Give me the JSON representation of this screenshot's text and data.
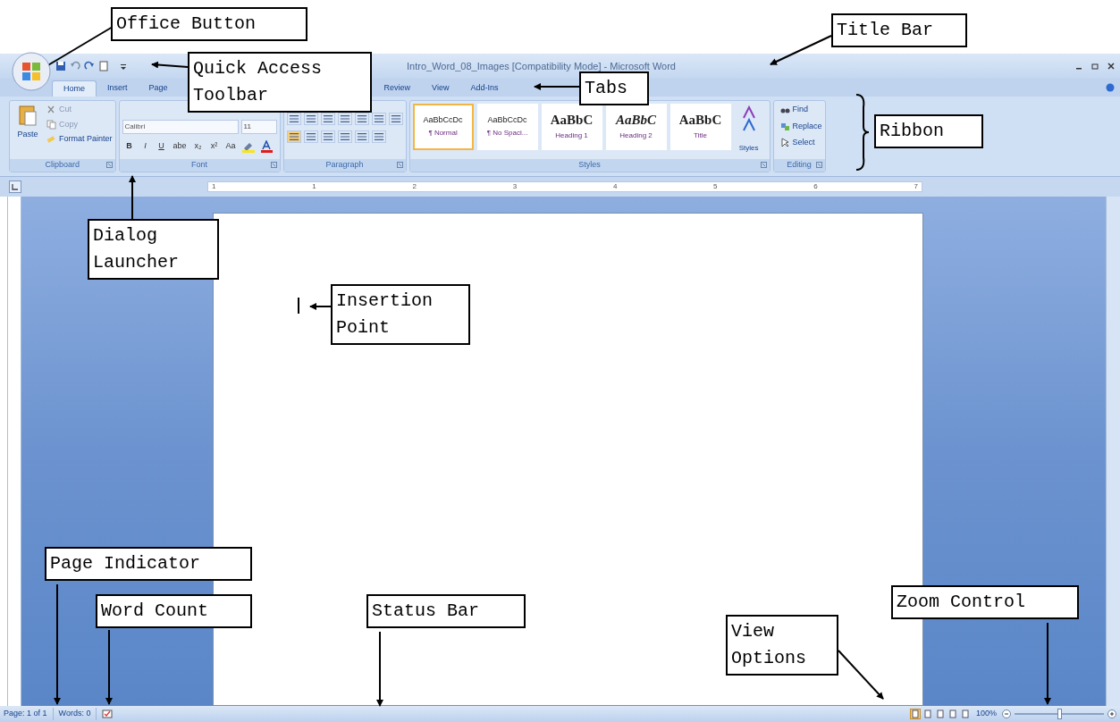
{
  "window": {
    "title": "Intro_Word_08_Images [Compatibility Mode] - Microsoft Word"
  },
  "tabs": [
    {
      "label": "Home",
      "selected": true
    },
    {
      "label": "Insert",
      "selected": false
    },
    {
      "label": "Page",
      "selected": false
    },
    {
      "label": "Review",
      "selected": false
    },
    {
      "label": "View",
      "selected": false
    },
    {
      "label": "Add-Ins",
      "selected": false
    }
  ],
  "ribbon": {
    "clipboard": {
      "label": "Clipboard",
      "paste": "Paste",
      "cut": "Cut",
      "copy": "Copy",
      "format_painter": "Format Painter"
    },
    "font": {
      "label": "Font",
      "font_name": "Calibri",
      "font_size": "11",
      "buttons": [
        "B",
        "I",
        "U",
        "abe",
        "x₂",
        "x²",
        "Aa"
      ]
    },
    "paragraph": {
      "label": "Paragraph"
    },
    "styles": {
      "label": "Styles",
      "items": [
        {
          "preview": "AaBbCcDc",
          "name": "¶ Normal",
          "selected": true,
          "kind": "body"
        },
        {
          "preview": "AaBbCcDc",
          "name": "¶ No Spaci...",
          "selected": false,
          "kind": "body"
        },
        {
          "preview": "AaBbC",
          "name": "Heading 1",
          "selected": false,
          "kind": "heading"
        },
        {
          "preview": "AaBbC",
          "name": "Heading 2",
          "selected": false,
          "kind": "italic"
        },
        {
          "preview": "AaBbC",
          "name": "Title",
          "selected": false,
          "kind": "heading"
        }
      ],
      "change_styles": "Styles"
    },
    "editing": {
      "label": "Editing",
      "find": "Find",
      "replace": "Replace",
      "select": "Select"
    }
  },
  "ruler": [
    "1",
    "1",
    "2",
    "3",
    "4",
    "5",
    "6",
    "7"
  ],
  "status_bar": {
    "page": "Page: 1 of 1",
    "words": "Words: 0",
    "views": [
      {
        "selected": true
      },
      {
        "selected": false
      },
      {
        "selected": false
      },
      {
        "selected": false
      },
      {
        "selected": false
      }
    ],
    "zoom": {
      "label": "100%",
      "level": 0.5
    }
  },
  "annotations": [
    {
      "text": "Office Button"
    },
    {
      "text": "Title Bar"
    },
    {
      "text": "Quick Access Toolbar"
    },
    {
      "text": "Tabs"
    },
    {
      "text": "Ribbon"
    },
    {
      "text": "Dialog Launcher"
    },
    {
      "text": "Insertion Point"
    },
    {
      "text": "Page Indicator"
    },
    {
      "text": "Word Count"
    },
    {
      "text": "Status Bar"
    },
    {
      "text": "View Options"
    },
    {
      "text": "Zoom Control"
    }
  ]
}
